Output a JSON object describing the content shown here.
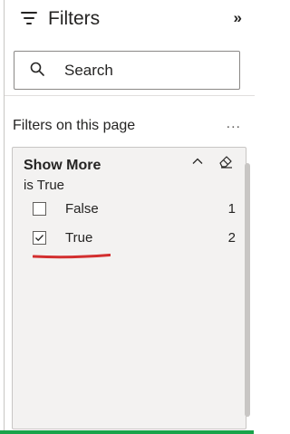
{
  "header": {
    "title": "Filters",
    "collapse_glyph": "»",
    "icons": [
      "filter-lines-icon",
      "collapse-pane-icon"
    ]
  },
  "search": {
    "placeholder": "Search",
    "icon": "search-icon"
  },
  "section": {
    "title": "Filters on this page",
    "more_glyph": "..."
  },
  "filter_card": {
    "field": "Show More",
    "state": "is True",
    "icons": [
      "chevron-up-icon",
      "eraser-icon"
    ],
    "options": [
      {
        "label": "False",
        "count": "1",
        "checked": false
      },
      {
        "label": "True",
        "count": "2",
        "checked": true
      }
    ]
  },
  "colors": {
    "annotation_underline": "#d32f2f",
    "bottom_bar": "#19a34a",
    "card_background": "#f3f2f1"
  }
}
